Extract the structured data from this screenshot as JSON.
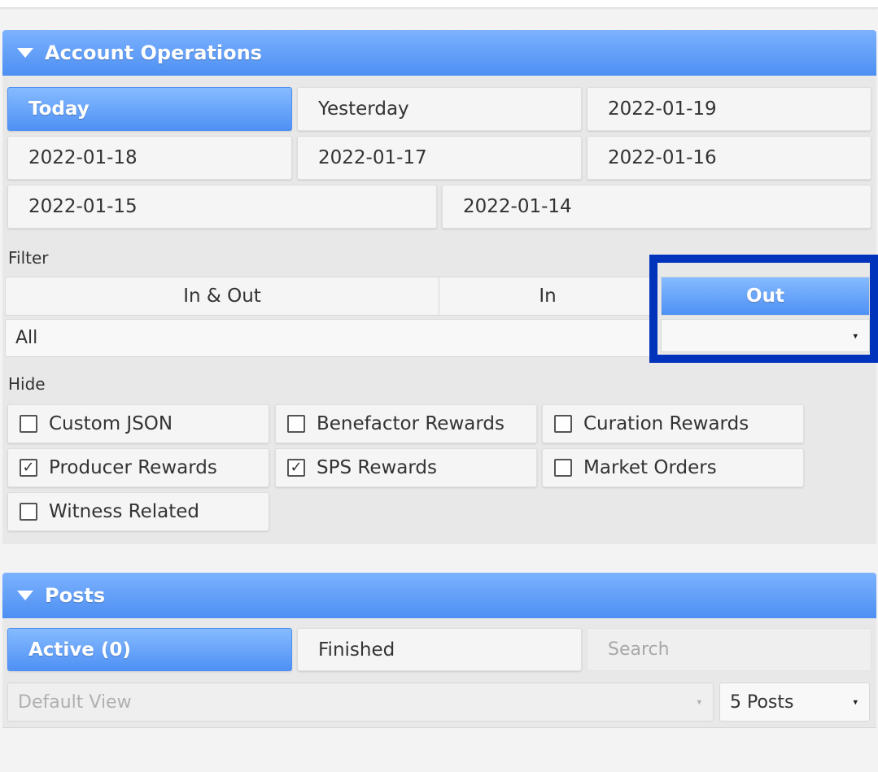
{
  "account_operations": {
    "title": "Account Operations",
    "date_buttons": [
      {
        "label": "Today",
        "active": true
      },
      {
        "label": "Yesterday",
        "active": false
      },
      {
        "label": "2022-01-19",
        "active": false
      },
      {
        "label": "2022-01-18",
        "active": false
      },
      {
        "label": "2022-01-17",
        "active": false
      },
      {
        "label": "2022-01-16",
        "active": false
      },
      {
        "label": "2022-01-15",
        "active": false
      },
      {
        "label": "2022-01-14",
        "active": false
      }
    ],
    "filter_label": "Filter",
    "filter_options": [
      {
        "label": "In & Out",
        "active": false
      },
      {
        "label": "In",
        "active": false
      },
      {
        "label": "Out",
        "active": true
      }
    ],
    "type_select_value": "All",
    "hide_label": "Hide",
    "hide_options": [
      {
        "label": "Custom JSON",
        "checked": false
      },
      {
        "label": "Benefactor Rewards",
        "checked": false
      },
      {
        "label": "Curation Rewards",
        "checked": false
      },
      {
        "label": "Producer Rewards",
        "checked": true
      },
      {
        "label": "SPS Rewards",
        "checked": true
      },
      {
        "label": "Market Orders",
        "checked": false
      },
      {
        "label": "Witness Related",
        "checked": false
      }
    ]
  },
  "posts": {
    "title": "Posts",
    "tabs": [
      {
        "label": "Active (0)",
        "active": true
      },
      {
        "label": "Finished",
        "active": false
      }
    ],
    "search_placeholder": "Search",
    "view_select_value": "Default View",
    "count_select_value": "5 Posts"
  },
  "colors": {
    "accent": "#4e90f4",
    "highlight_box": "#0033bb"
  },
  "icons": {
    "collapse": "triangle-down",
    "dropdown": "▾",
    "check": "✓"
  }
}
